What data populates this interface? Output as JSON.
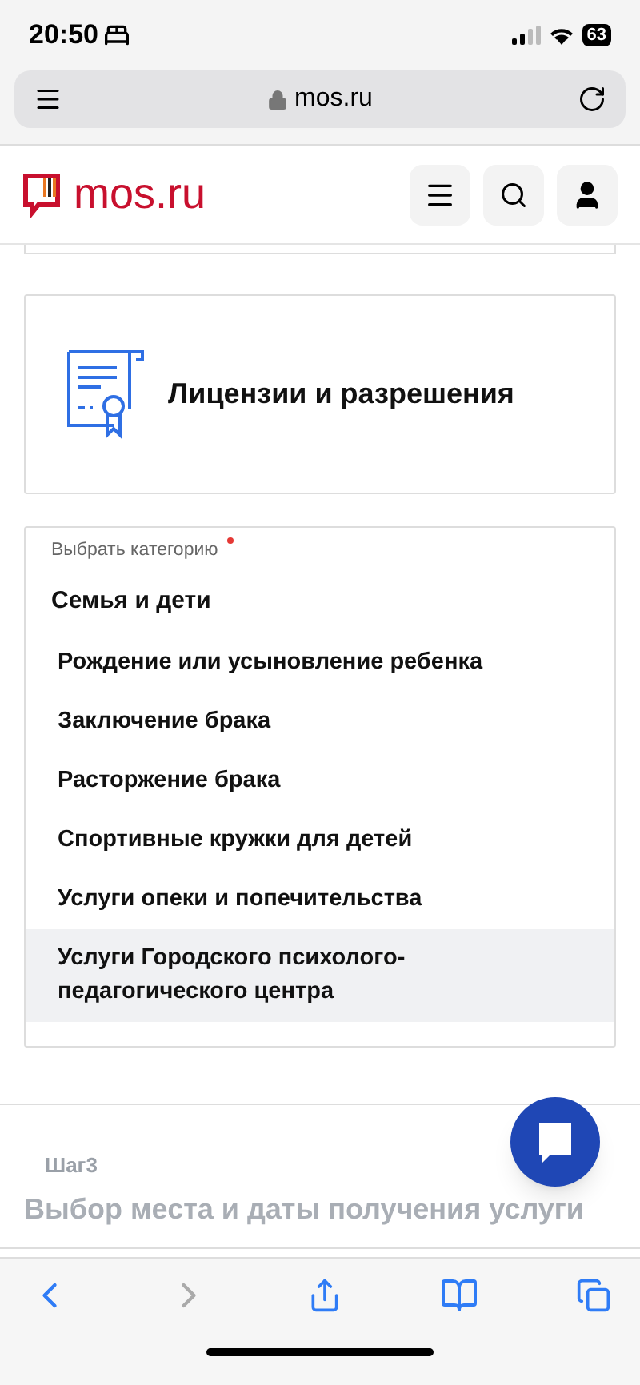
{
  "status_bar": {
    "time": "20:50",
    "battery": "63"
  },
  "browser": {
    "url": "mos.ru",
    "forward_disabled": true
  },
  "site": {
    "logo": "mos.ru"
  },
  "license_card": {
    "title": "Лицензии и разрешения"
  },
  "category": {
    "label": "Выбрать категорию",
    "required": true,
    "group": "Семья и дети",
    "items": [
      {
        "label": "Рождение или усыновление ребенка",
        "selected": false
      },
      {
        "label": "Заключение брака",
        "selected": false
      },
      {
        "label": "Расторжение брака",
        "selected": false
      },
      {
        "label": "Спортивные кружки для детей",
        "selected": false
      },
      {
        "label": "Услуги опеки и попечительства",
        "selected": false
      },
      {
        "label": "Услуги Городского психолого-педагогического центра",
        "selected": true
      }
    ]
  },
  "step": {
    "label": "Шаг3",
    "title": "Выбор места и даты получения услуги"
  }
}
